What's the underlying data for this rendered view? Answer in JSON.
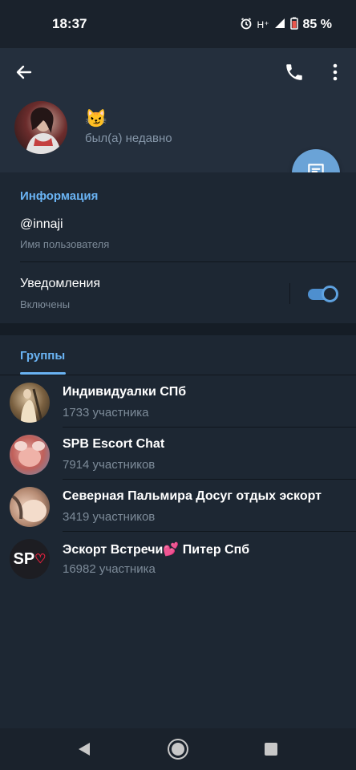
{
  "status_bar": {
    "time": "18:37",
    "network": "H⁺",
    "battery": "85 %"
  },
  "profile": {
    "emoji": "😼",
    "status": "был(а) недавно"
  },
  "info": {
    "section_title": "Информация",
    "username": "@innaji",
    "username_label": "Имя пользователя",
    "notifications_title": "Уведомления",
    "notifications_status": "Включены",
    "notifications_enabled": true
  },
  "groups": {
    "tab_title": "Группы",
    "items": [
      {
        "name": "Индивидуалки СПб",
        "count": "1733 участника"
      },
      {
        "name": "SPB Escort Chat",
        "count": "7914 участников"
      },
      {
        "name": "Северная Пальмира Досуг отдых эскорт",
        "count": "3419 участников"
      },
      {
        "name": "Эскорт Встречи💕 Питер Спб",
        "count": "16982 участника",
        "avatar_text": "SP"
      }
    ]
  },
  "icons": {
    "back": "arrow-left-icon",
    "call": "phone-icon",
    "more": "more-vertical-icon",
    "message": "message-icon",
    "alarm": "alarm-icon",
    "signal": "signal-icon",
    "battery": "battery-icon"
  },
  "colors": {
    "accent": "#6ab3f3",
    "fab": "#6aa3d7",
    "background": "#1d2733",
    "header": "#242f3d"
  }
}
